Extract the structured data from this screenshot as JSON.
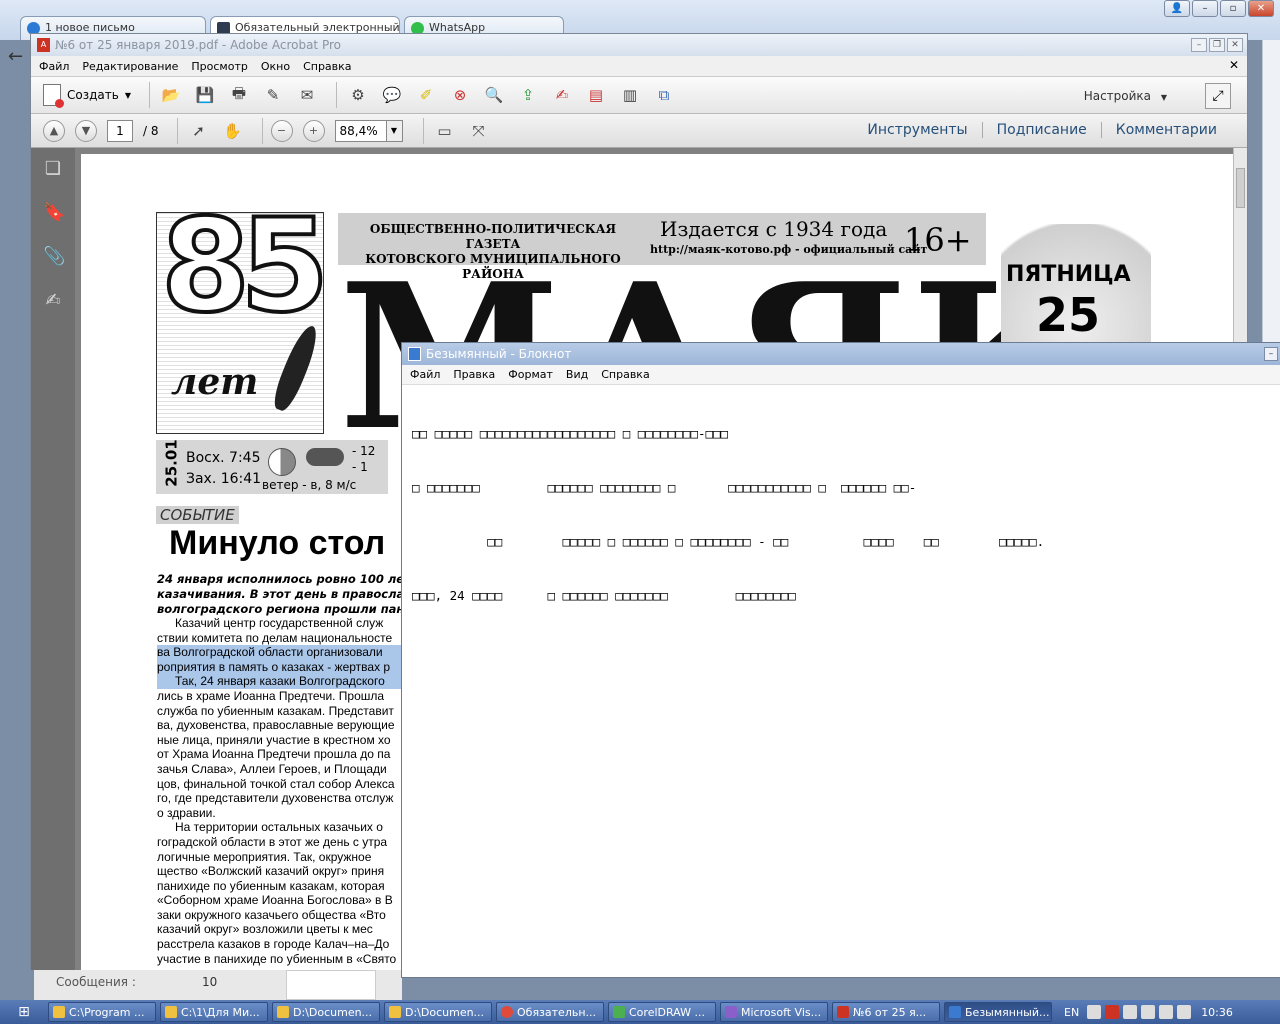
{
  "browser": {
    "tabs": [
      {
        "label": "1 новое письмо",
        "active": false
      },
      {
        "label": "Обязательный электронный",
        "active": true
      },
      {
        "label": "WhatsApp",
        "active": false
      }
    ]
  },
  "acrobat": {
    "title": "№6 от 25 января 2019.pdf - Adobe Acrobat Pro",
    "menu": [
      "Файл",
      "Редактирование",
      "Просмотр",
      "Окно",
      "Справка"
    ],
    "create_label": "Создать",
    "settings_label": "Настройка",
    "page_current": "1",
    "page_total": "/ 8",
    "zoom": "88,4%",
    "panes": [
      "Инструменты",
      "Подписание",
      "Комментарии"
    ]
  },
  "newspaper": {
    "anniversary_number": "85",
    "anniversary_word": "лет",
    "subtitle_line1": "ОБЩЕСТВЕННО-ПОЛИТИЧЕСКАЯ ГАЗЕТА",
    "subtitle_line2": "КОТОВСКОГО МУНИЦИПАЛЬНОГО РАЙОНА",
    "since": "Издается с 1934 года",
    "site": "http://маяк-котово.рф - официальный сайт",
    "age_rating": "16+",
    "title": "МАЯК",
    "weekday": "ПЯТНИЦА",
    "day_number": "25",
    "weather": {
      "date": "25.01",
      "sunrise": "Восх.  7:45",
      "sunset": "Зах. 16:41",
      "temp_day": "- 12",
      "temp_night": "- 1",
      "wind": "ветер - в, 8 м/с"
    },
    "rubric": "СОБЫТИЕ",
    "headline": "Минуло стол",
    "lead": [
      "24 января исполнилось ровно 100 ле",
      "казачивания. В этот день в правосла",
      "волгоградского региона прошли панихи"
    ],
    "body": [
      "Казачий центр государственной служ",
      "ствии комитета по делам национальносте",
      "ва Волгоградской области организовали",
      "роприятия в память о казаках - жертвах р",
      "Так, 24 января казаки Волгоградского",
      "лись в храме Иоанна Предтечи. Прошла",
      "служба по убиенным казакам. Представит",
      "ва, духовенства, православные верующие",
      "ные лица, приняли участие в крестном хо",
      "от Храма Иоанна Предтечи прошла до па",
      "зачья Слава», Аллеи Героев, и Площади",
      "цов, финальной точкой стал собор Алекса",
      "го, где представители духовенства отслуж",
      "о здравии.",
      "На территории остальных казачьих о",
      "гоградской области в этот же день с утра",
      "логичные мероприятия. Так, окружное",
      "щество «Волжский казачий округ» приня",
      "панихиде по убиенным казакам, которая",
      "«Соборном храме Иоанна Богослова» в В",
      "заки окружного казачьего общества «Вто",
      "казачий округ» возложили цветы к мес",
      "расстрела казаков в городе Калач–на–До",
      "участие в панихиде по убиенным в «Свято"
    ]
  },
  "notepad": {
    "title": "Безымянный - Блокнот",
    "menu": [
      "Файл",
      "Правка",
      "Формат",
      "Вид",
      "Справка"
    ],
    "lines": [
      "□□ □□□□□ □□□□□□□□□□□□□□□□□□ □ □□□□□□□□-□□□",
      "□ □□□□□□□         □□□□□□ □□□□□□□□ □       □□□□□□□□□□□ □  □□□□□□ □□-",
      "          □□        □□□□□ □ □□□□□□ □ □□□□□□□□ - □□          □□□□    □□        □□□□□.",
      "□□□, 24 □□□□      □ □□□□□□ □□□□□□□         □□□□□□□□"
    ]
  },
  "status": {
    "label": "Сообщения :",
    "value": "10"
  },
  "taskbar": {
    "items": [
      {
        "label": "C:\\Program ...",
        "active": false
      },
      {
        "label": "C:\\1\\Для Ми...",
        "active": false
      },
      {
        "label": "D:\\Documen...",
        "active": false
      },
      {
        "label": "D:\\Documen...",
        "active": false
      },
      {
        "label": "Обязательн...",
        "active": false
      },
      {
        "label": "CorelDRAW ...",
        "active": false
      },
      {
        "label": "Microsoft Vis...",
        "active": false
      },
      {
        "label": "№6 от 25 я...",
        "active": false
      },
      {
        "label": "Безымянный...",
        "active": true
      }
    ],
    "lang": "EN",
    "clock": "10:36"
  }
}
